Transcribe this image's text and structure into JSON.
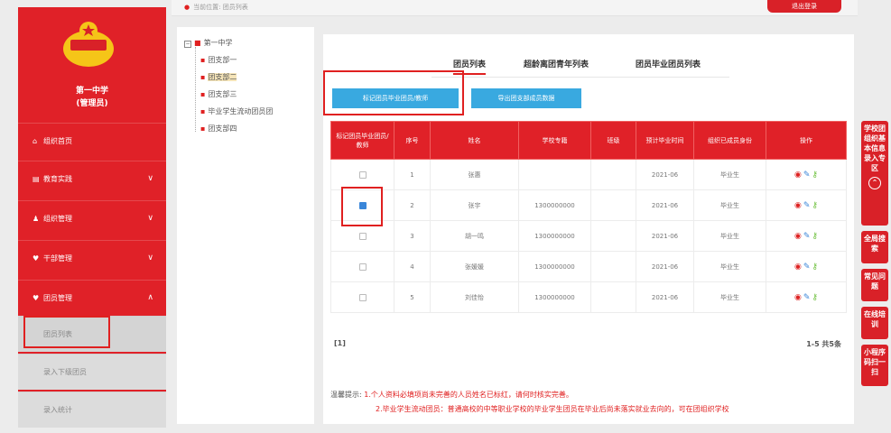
{
  "topbar": {
    "crumb": "当前位置: 团员列表",
    "logout": "退出登录"
  },
  "sidebar": {
    "school": "第一中学",
    "sub": "(管理员)",
    "items": [
      {
        "icon": "home-icon",
        "label": "组织首页",
        "chev": ""
      },
      {
        "icon": "list-icon",
        "label": "教育实践",
        "chev": "∨"
      },
      {
        "icon": "person-icon",
        "label": "组织管理",
        "chev": "∨"
      },
      {
        "icon": "heart-icon",
        "label": "干部管理",
        "chev": "∨"
      },
      {
        "icon": "heart-icon",
        "label": "团员管理",
        "chev": "∧"
      }
    ],
    "sub_items": [
      "团员列表",
      "录入下级团员",
      "录入统计"
    ]
  },
  "tree": {
    "root": "第一中学",
    "children": [
      "团支部一",
      "团支部二",
      "团支部三",
      "毕业学生流动团员团",
      "团支部四"
    ]
  },
  "tabs": [
    "团员列表",
    "超龄离团青年列表",
    "团员毕业团员列表"
  ],
  "buttons": {
    "mark": "标记团员毕业团员/教师",
    "export": "导出团支部成员数据"
  },
  "table": {
    "headers": [
      "标记团员毕业团员/教师",
      "序号",
      "姓名",
      "学校专籍",
      "班级",
      "预计毕业时间",
      "组织已成员身份",
      "操作"
    ],
    "rows": [
      {
        "idx": "1",
        "name": "张惠",
        "school": "",
        "class": "",
        "date": "2021-06",
        "status": "毕业生",
        "checked": false
      },
      {
        "idx": "2",
        "name": "张宇",
        "school": "1300000000",
        "class": "",
        "date": "2021-06",
        "status": "毕业生",
        "checked": true
      },
      {
        "idx": "3",
        "name": "胡一鸣",
        "school": "1300000000",
        "class": "",
        "date": "2021-06",
        "status": "毕业生",
        "checked": false
      },
      {
        "idx": "4",
        "name": "张媛媛",
        "school": "1300000000",
        "class": "",
        "date": "2021-06",
        "status": "毕业生",
        "checked": false
      },
      {
        "idx": "5",
        "name": "刘佳怡",
        "school": "1300000000",
        "class": "",
        "date": "2021-06",
        "status": "毕业生",
        "checked": false
      }
    ]
  },
  "pager": {
    "left": "[1]",
    "right": "1-5 共5条"
  },
  "notice": {
    "label": "温馨提示:",
    "line1": "1.个人资料必填项尚未完善的人员姓名已标红，请何时核实完善。",
    "line2": "2.毕业学生流动团员：普通高校的中等职业学校的毕业学生团员在毕业后尚未落实就业去向的，可在团组织学校"
  },
  "right_buttons": [
    "学校团组织基本信息录入专区",
    "全局搜索",
    "常见问题",
    "在线培训",
    "小程序码扫一扫"
  ],
  "colors": {
    "primary": "#e02128",
    "button_blue": "#39a9e0",
    "checkbox_blue": "#3a86d9"
  }
}
